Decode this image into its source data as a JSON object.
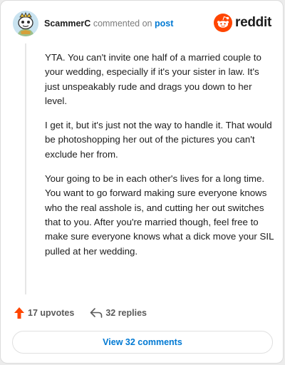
{
  "header": {
    "username": "ScammerC",
    "action_text": "commented on",
    "target_link": "post",
    "brand": "reddit"
  },
  "comment": {
    "paragraphs": [
      "YTA. You can't invite one half of a married couple to your wedding, especially if it's your sister in law. It's just unspeakably rude and drags you down to her level.",
      "I get it, but it's just not the way to handle it. That would be photoshopping her out of the pictures you can't exclude her from.",
      "Your going to be in each other's lives for a long time. You want to go forward making sure everyone knows who the real asshole is, and cutting her out switches that to you. After you're married though, feel free to make sure everyone knows what a dick move your SIL pulled at her wedding."
    ]
  },
  "actions": {
    "upvotes_label": "17 upvotes",
    "replies_label": "32 replies"
  },
  "footer": {
    "view_comments_label": "View 32 comments"
  },
  "colors": {
    "accent": "#0079d3",
    "upvote": "#ff4500",
    "reddit_orange": "#ff4500"
  },
  "icons": {
    "avatar": "snoo-avatar",
    "brand": "reddit-logo-icon",
    "upvote": "upvote-arrow-icon",
    "reply": "reply-arrow-icon"
  }
}
